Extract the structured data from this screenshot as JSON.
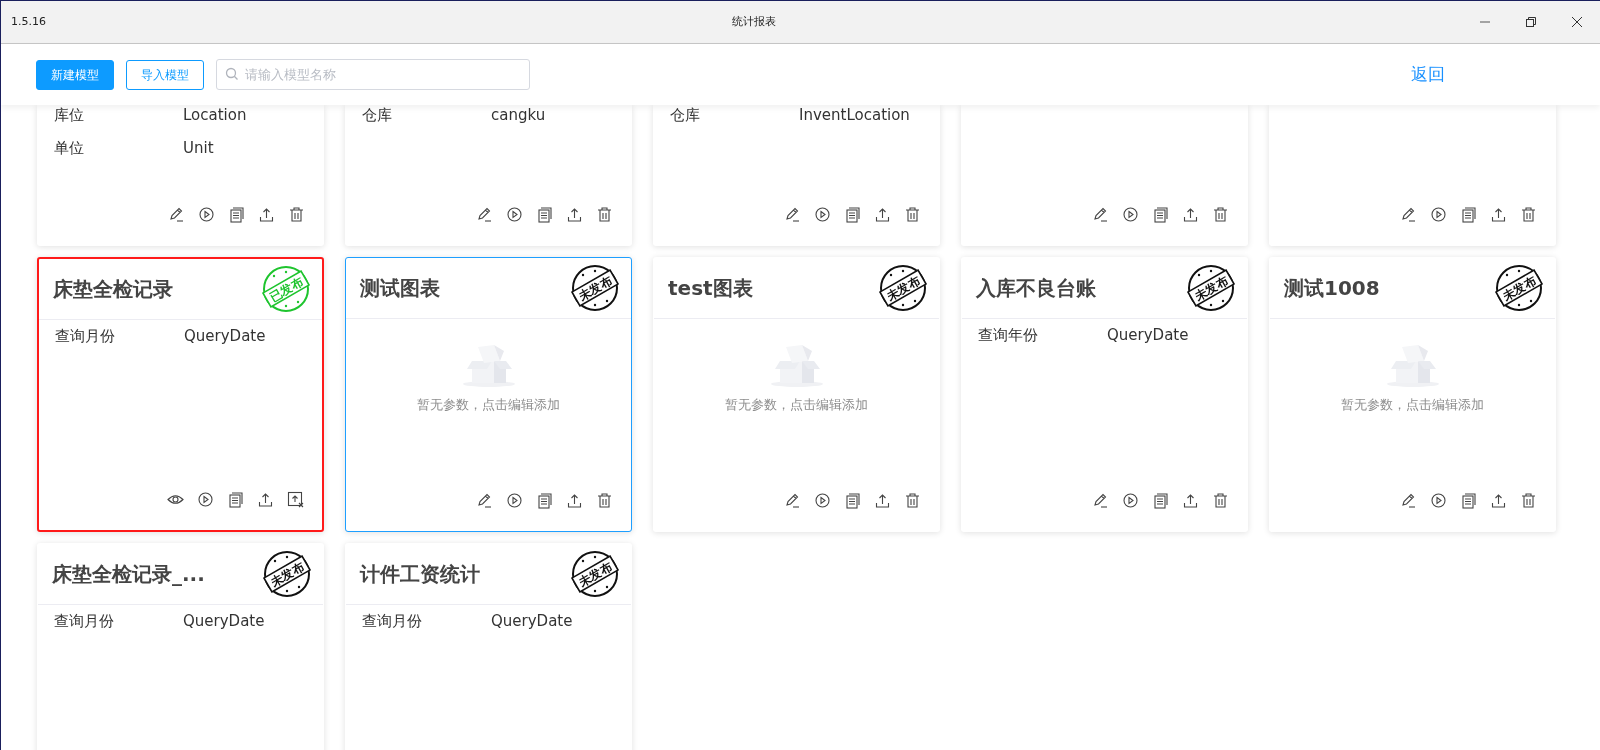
{
  "window": {
    "version": "1.5.16",
    "title": "统计报表"
  },
  "toolbar": {
    "buttons": [
      {
        "label": "新建模型",
        "kind": "primary"
      },
      {
        "label": "导入模型",
        "kind": "outline"
      }
    ],
    "search": {
      "placeholder": "请输入模型名称"
    },
    "back_link": "返回"
  },
  "card_rows": [
    [
      {
        "selected": false,
        "hovered": false,
        "params": [
          {
            "label": "库位",
            "value": "Location"
          },
          {
            "label": "单位",
            "value": "Unit"
          }
        ],
        "actions": [
          {
            "kind": "edit"
          },
          {
            "kind": "run"
          },
          {
            "kind": "copy"
          },
          {
            "kind": "export"
          },
          {
            "kind": "delete"
          }
        ]
      },
      {
        "selected": false,
        "hovered": false,
        "params": [
          {
            "label": "仓库",
            "value": "cangku"
          }
        ],
        "actions": [
          {
            "kind": "edit"
          },
          {
            "kind": "run"
          },
          {
            "kind": "copy"
          },
          {
            "kind": "export"
          },
          {
            "kind": "delete"
          }
        ]
      },
      {
        "selected": false,
        "hovered": false,
        "params": [
          {
            "label": "仓库",
            "value": "InventLocation"
          }
        ],
        "actions": [
          {
            "kind": "edit"
          },
          {
            "kind": "run"
          },
          {
            "kind": "copy"
          },
          {
            "kind": "export"
          },
          {
            "kind": "delete"
          }
        ]
      },
      {
        "selected": false,
        "hovered": false,
        "actions": [
          {
            "kind": "edit"
          },
          {
            "kind": "run"
          },
          {
            "kind": "copy"
          },
          {
            "kind": "export"
          },
          {
            "kind": "delete"
          }
        ]
      },
      {
        "selected": false,
        "hovered": false,
        "actions": [
          {
            "kind": "edit"
          },
          {
            "kind": "run"
          },
          {
            "kind": "copy"
          },
          {
            "kind": "export"
          },
          {
            "kind": "delete"
          }
        ]
      }
    ],
    [
      {
        "title": "床垫全检记录",
        "stamp": "已发布",
        "published": true,
        "selected": true,
        "hovered": false,
        "params": [
          {
            "label": "查询月份",
            "value": "QueryDate"
          }
        ],
        "actions": [
          {
            "kind": "view"
          },
          {
            "kind": "run"
          },
          {
            "kind": "copy"
          },
          {
            "kind": "export"
          },
          {
            "kind": "unpublish"
          }
        ]
      },
      {
        "title": "测试图表",
        "stamp": "未发布",
        "published": false,
        "selected": false,
        "hovered": true,
        "empty_text": "暂无参数，点击编辑添加",
        "actions": [
          {
            "kind": "edit"
          },
          {
            "kind": "run"
          },
          {
            "kind": "copy"
          },
          {
            "kind": "export"
          },
          {
            "kind": "delete"
          }
        ]
      },
      {
        "title": "test图表",
        "stamp": "未发布",
        "published": false,
        "selected": false,
        "hovered": false,
        "empty_text": "暂无参数，点击编辑添加",
        "actions": [
          {
            "kind": "edit"
          },
          {
            "kind": "run"
          },
          {
            "kind": "copy"
          },
          {
            "kind": "export"
          },
          {
            "kind": "delete"
          }
        ]
      },
      {
        "title": "入库不良台账",
        "stamp": "未发布",
        "published": false,
        "selected": false,
        "hovered": false,
        "params": [
          {
            "label": "查询年份",
            "value": "QueryDate"
          }
        ],
        "actions": [
          {
            "kind": "edit"
          },
          {
            "kind": "run"
          },
          {
            "kind": "copy"
          },
          {
            "kind": "export"
          },
          {
            "kind": "delete"
          }
        ]
      },
      {
        "title": "测试1008",
        "stamp": "未发布",
        "published": false,
        "selected": false,
        "hovered": false,
        "empty_text": "暂无参数，点击编辑添加",
        "actions": [
          {
            "kind": "edit"
          },
          {
            "kind": "run"
          },
          {
            "kind": "copy"
          },
          {
            "kind": "export"
          },
          {
            "kind": "delete"
          }
        ]
      }
    ],
    [
      {
        "title": "床垫全检记录_...",
        "stamp": "未发布",
        "published": false,
        "selected": false,
        "hovered": false,
        "params": [
          {
            "label": "查询月份",
            "value": "QueryDate"
          }
        ]
      },
      {
        "title": "计件工资统计",
        "stamp": "未发布",
        "published": false,
        "selected": false,
        "hovered": false,
        "params": [
          {
            "label": "查询月份",
            "value": "QueryDate"
          }
        ]
      }
    ]
  ]
}
